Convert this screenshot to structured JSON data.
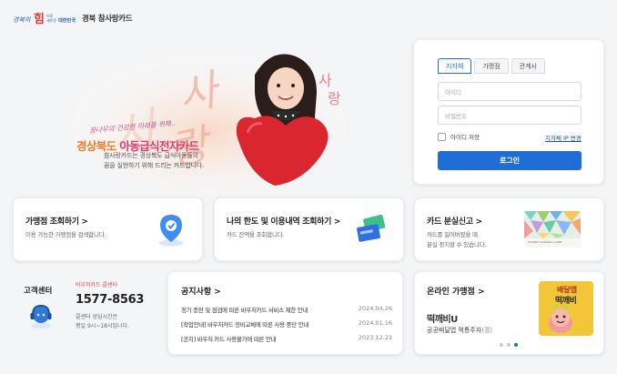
{
  "header": {
    "logo_text": "경북의 힘으로 새로운 대한민국",
    "site_title": "경북 참사랑카드"
  },
  "banner": {
    "tagline": "꿈나무의 건강한 미래를 위해..",
    "title_prefix": "경상북도 ",
    "title_main": "아동급식전자카드",
    "desc_line1": "참사랑카드는 경상북도 급식아동들의",
    "desc_line2": "꿈을 실현하기 위해 드리는 카드입니다.",
    "bg_text": "사랑"
  },
  "login": {
    "tabs": [
      "지자체",
      "가맹점",
      "관계사"
    ],
    "active_tab": "지자체",
    "id_placeholder": "아이디",
    "pw_placeholder": "비밀번호",
    "remember_label": "아이디 저장",
    "ip_link": "지자체 IP 변경",
    "submit_label": "로그인"
  },
  "services": {
    "store": {
      "title": "가맹점 조회하기 >",
      "desc": "이용 가능한 가맹점을 검색합니다."
    },
    "limit": {
      "title": "나의 한도 및 이용내역 조회하기 >",
      "desc": "카드 잔액을 조회합니다."
    },
    "lost": {
      "title": "카드 분실신고 >",
      "desc_line1": "카드를 잃어버렸을 때",
      "desc_line2": "분실 정지할 수 있습니다.",
      "card_text": "CHARM SARANG CARD"
    }
  },
  "customer_center": {
    "label": "고객센터",
    "sub": "바우처카드 콜센터",
    "phone": "1577-8563",
    "hours_line1": "콜센터 상담시간은",
    "hours_line2": "평일 9시~18시입니다."
  },
  "notices": {
    "title": "공지사항 >",
    "items": [
      {
        "text": "정기 충전 및 점검에 따른 바우처카드 서비스 제한 안내",
        "date": "2024.04.26"
      },
      {
        "text": "[작업안내] 바우처카드 장비교체에 따른 사용 중단 안내",
        "date": "2024.01.16"
      },
      {
        "text": "[공지] 바우처 카드 사용불가에 따른 안내",
        "date": "2023.12.23"
      }
    ]
  },
  "online_store": {
    "title": "온라인 가맹점 >",
    "name": "떡깨비U",
    "desc": "공공배달앱 먹통주자",
    "desc_tail": "(경)",
    "thumb_text_1": "배달앱",
    "thumb_text_2": "떡깨비",
    "dots": 3,
    "active_dot": 3
  },
  "colors": {
    "primary": "#1f6ed8",
    "title_pink": "#e3396b",
    "title_orange": "#f07c2a",
    "tag_pink": "#c05a96",
    "phone_red": "#e0484e"
  }
}
